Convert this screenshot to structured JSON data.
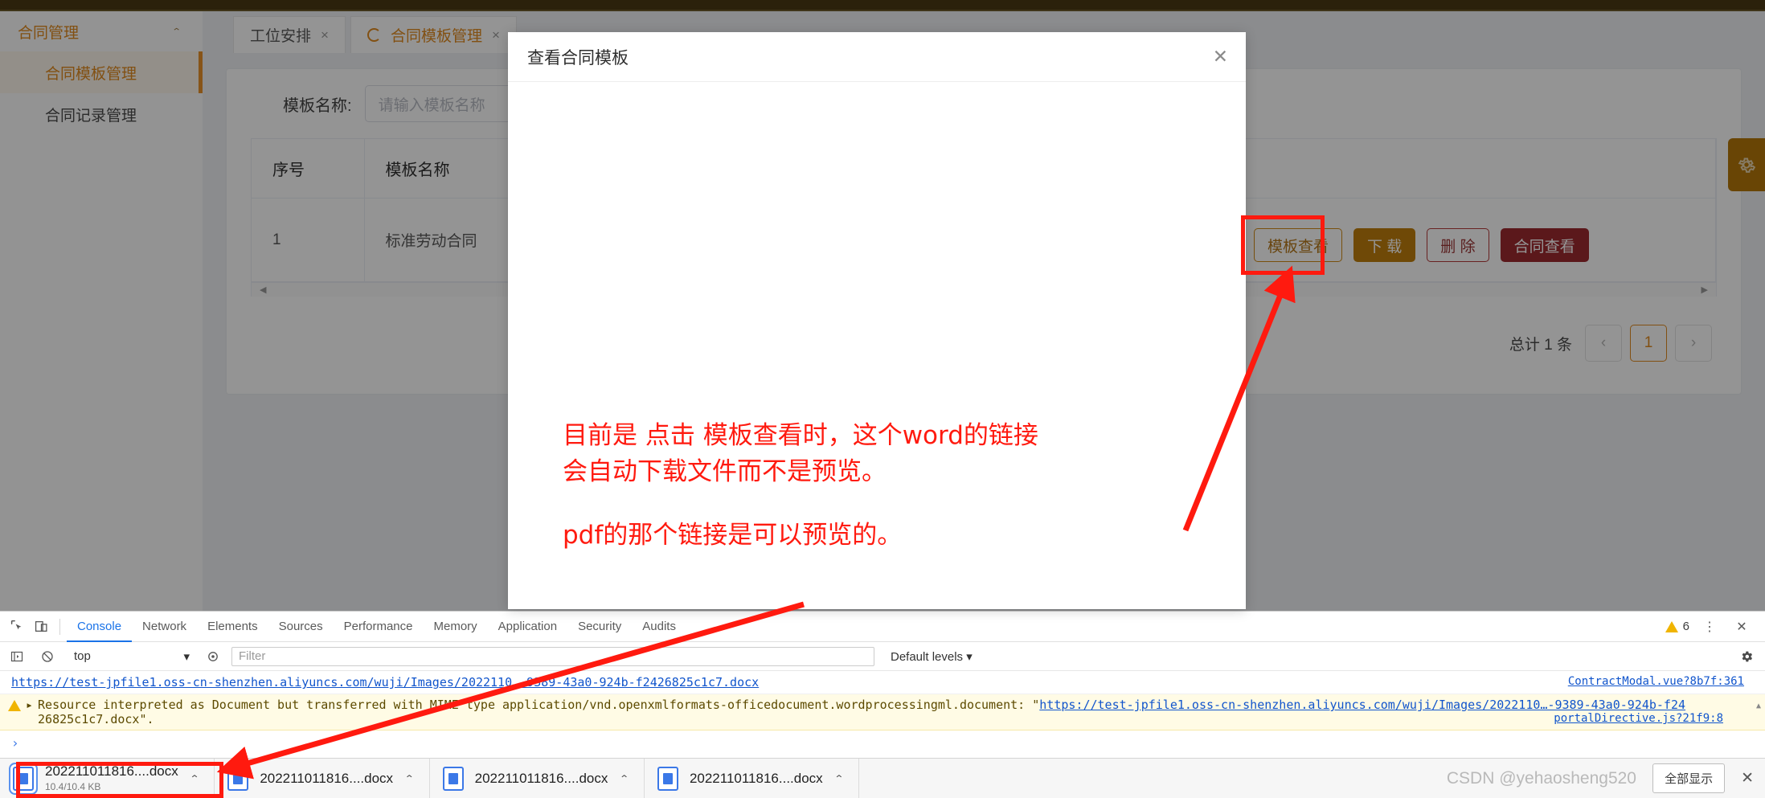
{
  "sidebar": {
    "group_label": "合同管理",
    "collapse_icon": "chevron-up-icon",
    "items": [
      {
        "label": "合同模板管理",
        "active": true
      },
      {
        "label": "合同记录管理",
        "active": false
      }
    ]
  },
  "tabs": [
    {
      "label": "工位安排",
      "close": "×",
      "active": false,
      "spinner": false
    },
    {
      "label": "合同模板管理",
      "close": "×",
      "active": true,
      "spinner": true
    }
  ],
  "search": {
    "label": "模板名称:",
    "placeholder": "请输入模板名称",
    "value": ""
  },
  "table": {
    "headers": [
      "序号",
      "模板名称"
    ],
    "rows": [
      {
        "no": "1",
        "name": "标准劳动合同"
      }
    ],
    "hscroll_left_arrow": "◀",
    "hscroll_right_arrow": "▶"
  },
  "row_actions": [
    {
      "label": "模板查看",
      "style": "ghost-orange"
    },
    {
      "label": "下 载",
      "style": "solid-orange"
    },
    {
      "label": "删 除",
      "style": "ghost-red"
    },
    {
      "label": "合同查看",
      "style": "solid-red"
    }
  ],
  "pagination": {
    "total_text": "总计 1 条",
    "prev": "‹",
    "pages": [
      "1"
    ],
    "next": "›",
    "current": "1"
  },
  "side_gear": {
    "icon": "gear-icon"
  },
  "modal": {
    "title": "查看合同模板",
    "close": "✕",
    "body_text": ""
  },
  "annotation": {
    "line1": "目前是 点击 模板查看时，这个word的链接",
    "line2": "会自动下载文件而不是预览。",
    "line3": "pdf的那个链接是可以预览的。",
    "color": "#ff1a0f"
  },
  "devtools": {
    "left_icons": [
      "inspect-element-icon",
      "device-toolbar-icon"
    ],
    "tabs": [
      {
        "label": "Console",
        "active": true
      },
      {
        "label": "Network",
        "active": false
      },
      {
        "label": "Elements",
        "active": false
      },
      {
        "label": "Sources",
        "active": false
      },
      {
        "label": "Performance",
        "active": false
      },
      {
        "label": "Memory",
        "active": false
      },
      {
        "label": "Application",
        "active": false
      },
      {
        "label": "Security",
        "active": false
      },
      {
        "label": "Audits",
        "active": false
      }
    ],
    "warning_count": "6",
    "warning_icon": "warning-triangle-icon",
    "more_icon": "kebab-menu-icon",
    "close_icon": "close-icon",
    "filterbar": {
      "execute_icon": "sidebar-toggle-icon",
      "clear_icon": "clear-console-icon",
      "context": "top",
      "context_caret": "▾",
      "eye_icon": "live-expression-icon",
      "filter_placeholder": "Filter",
      "levels": "Default levels",
      "levels_caret": "▾",
      "settings_icon": "gear-icon"
    },
    "logs": [
      {
        "type": "link",
        "text": "https://test-jpfile1.oss-cn-shenzhen.aliyuncs.com/wuji/Images/2022110…-9389-43a0-924b-f2426825c1c7.docx",
        "source": "ContractModal.vue?8b7f:361"
      },
      {
        "type": "warning",
        "expand_arrow": "▸",
        "text_before": "Resource interpreted as Document but transferred with MIME type application/vnd.openxmlformats-officedocument.wordprocessingml.document: \"",
        "link": "https://test-jpfile1.oss-cn-shenzhen.aliyuncs.com/wuji/Images/2022110…-9389-43a0-924b-f24",
        "text_after2": "26825c1c7.docx\".",
        "source": "portalDirective.js?21f9:8"
      }
    ],
    "prompt": "›"
  },
  "downloads": {
    "items": [
      {
        "name": "202211011816....docx",
        "sub": "10.4/10.4 KB",
        "chevron": "⌃",
        "highlighted": true
      },
      {
        "name": "202211011816....docx",
        "sub": "",
        "chevron": "⌃",
        "highlighted": false
      },
      {
        "name": "202211011816....docx",
        "sub": "",
        "chevron": "⌃",
        "highlighted": false
      },
      {
        "name": "202211011816....docx",
        "sub": "",
        "chevron": "⌃",
        "highlighted": false
      }
    ],
    "show_all": "全部显示",
    "close": "✕"
  },
  "watermark": "CSDN @yehaosheng520"
}
